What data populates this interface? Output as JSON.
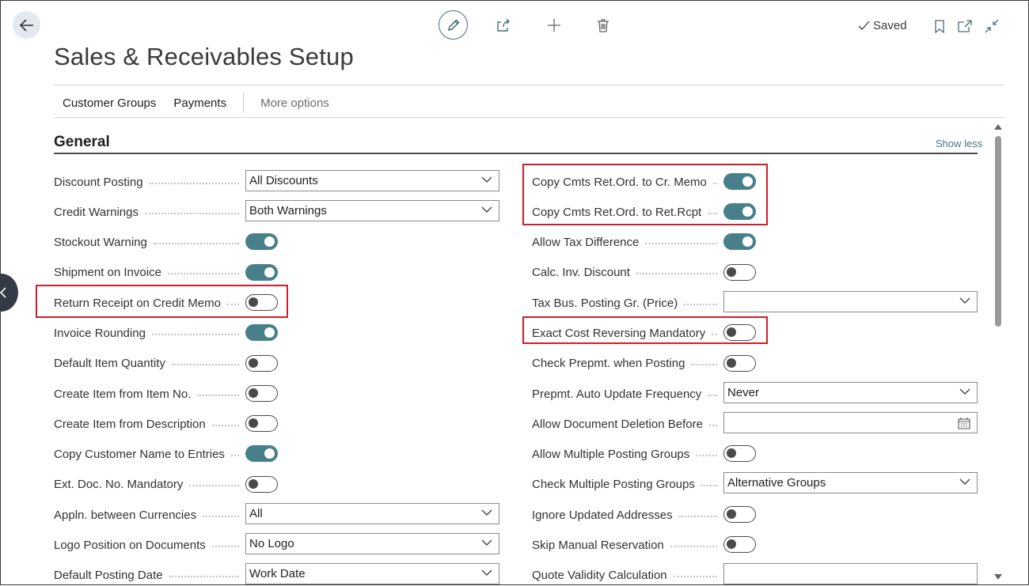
{
  "toolbar": {
    "saved_label": "Saved",
    "icons": [
      "back-arrow-icon",
      "pencil-icon",
      "share-icon",
      "plus-icon",
      "trash-icon",
      "checkmark-icon",
      "bookmark-icon",
      "open-new-window-icon",
      "collapse-icon"
    ]
  },
  "page": {
    "title": "Sales & Receivables Setup"
  },
  "actions": {
    "items": [
      "Customer Groups",
      "Payments"
    ],
    "more": "More options"
  },
  "section": {
    "title": "General",
    "toggle": "Show less"
  },
  "left_fields": [
    {
      "label": "Discount Posting",
      "type": "select",
      "value": "All Discounts"
    },
    {
      "label": "Credit Warnings",
      "type": "select",
      "value": "Both Warnings"
    },
    {
      "label": "Stockout Warning",
      "type": "toggle",
      "on": true
    },
    {
      "label": "Shipment on Invoice",
      "type": "toggle",
      "on": true
    },
    {
      "label": "Return Receipt on Credit Memo",
      "type": "toggle",
      "on": false,
      "highlighted": true
    },
    {
      "label": "Invoice Rounding",
      "type": "toggle",
      "on": true
    },
    {
      "label": "Default Item Quantity",
      "type": "toggle",
      "on": false
    },
    {
      "label": "Create Item from Item No.",
      "type": "toggle",
      "on": false
    },
    {
      "label": "Create Item from Description",
      "type": "toggle",
      "on": false
    },
    {
      "label": "Copy Customer Name to Entries",
      "type": "toggle",
      "on": true
    },
    {
      "label": "Ext. Doc. No. Mandatory",
      "type": "toggle",
      "on": false
    },
    {
      "label": "Appln. between Currencies",
      "type": "select",
      "value": "All"
    },
    {
      "label": "Logo Position on Documents",
      "type": "select",
      "value": "No Logo"
    },
    {
      "label": "Default Posting Date",
      "type": "select",
      "value": "Work Date"
    }
  ],
  "right_fields": [
    {
      "label": "Copy Cmts Ret.Ord. to Cr. Memo",
      "type": "toggle",
      "on": true,
      "highlighted": true
    },
    {
      "label": "Copy Cmts Ret.Ord. to Ret.Rcpt",
      "type": "toggle",
      "on": true,
      "highlighted": true
    },
    {
      "label": "Allow Tax Difference",
      "type": "toggle",
      "on": true
    },
    {
      "label": "Calc. Inv. Discount",
      "type": "toggle",
      "on": false
    },
    {
      "label": "Tax Bus. Posting Gr. (Price)",
      "type": "select",
      "value": ""
    },
    {
      "label": "Exact Cost Reversing Mandatory",
      "type": "toggle",
      "on": false,
      "highlighted": true
    },
    {
      "label": "Check Prepmt. when Posting",
      "type": "toggle",
      "on": false
    },
    {
      "label": "Prepmt. Auto Update Frequency",
      "type": "select",
      "value": "Never"
    },
    {
      "label": "Allow Document Deletion Before",
      "type": "date",
      "value": ""
    },
    {
      "label": "Allow Multiple Posting Groups",
      "type": "toggle",
      "on": false
    },
    {
      "label": "Check Multiple Posting Groups",
      "type": "select",
      "value": "Alternative Groups"
    },
    {
      "label": "Ignore Updated Addresses",
      "type": "toggle",
      "on": false
    },
    {
      "label": "Skip Manual Reservation",
      "type": "toggle",
      "on": false
    },
    {
      "label": "Quote Validity Calculation",
      "type": "text",
      "value": ""
    }
  ],
  "colors": {
    "accent": "#477f8b",
    "highlight": "#cc1f2b"
  }
}
